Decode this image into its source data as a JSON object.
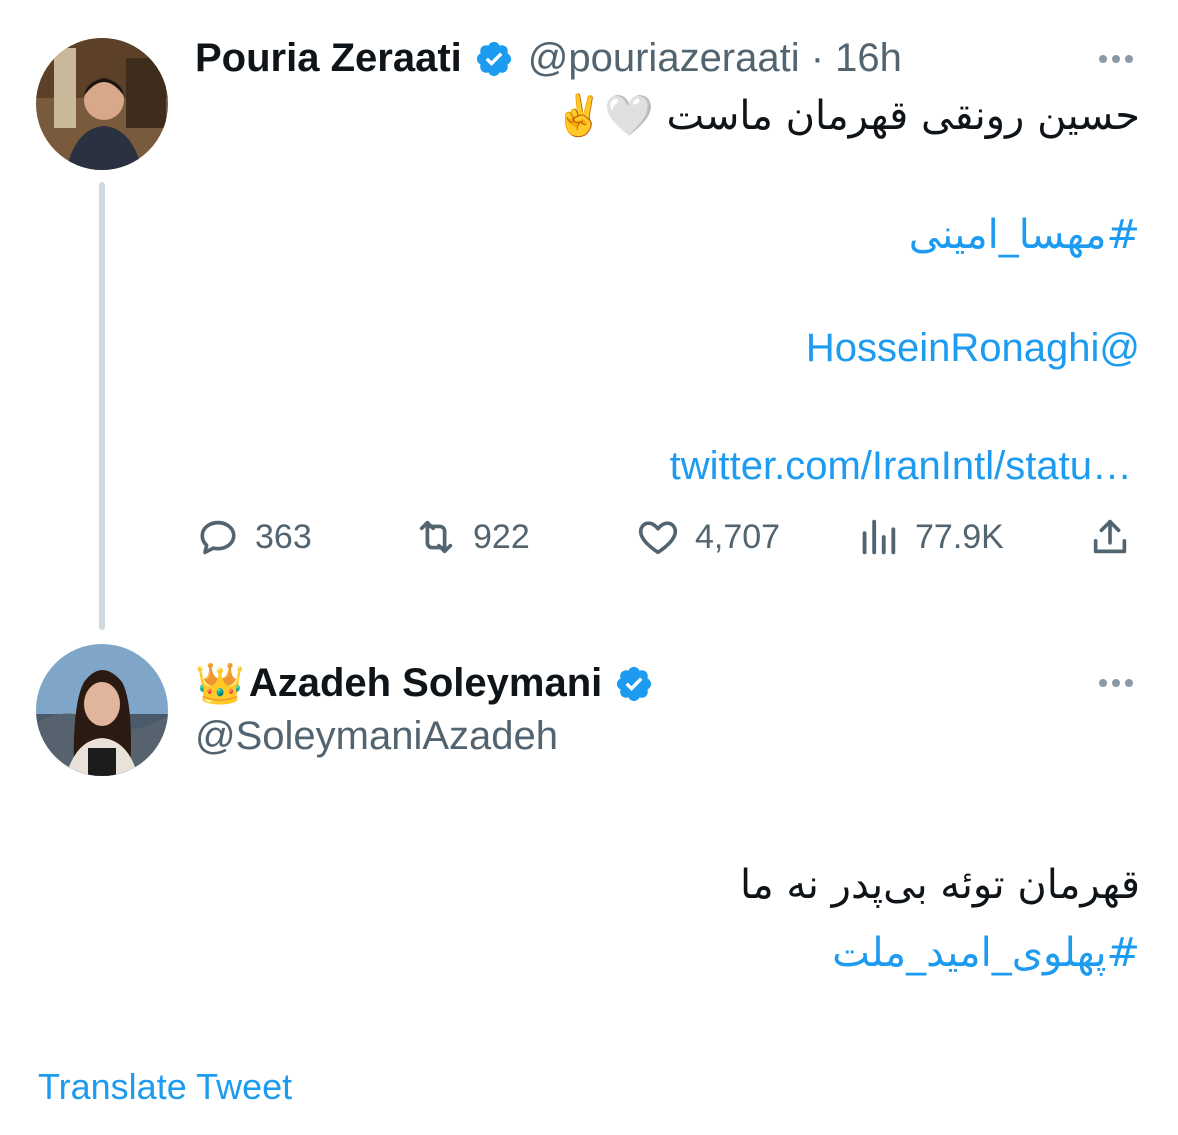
{
  "tweet1": {
    "name": "Pouria Zeraati",
    "handle_time": "@pouriazeraati · 16h",
    "text": "حسین رونقی قهرمان ماست 🤍✌️",
    "hashtag": "#مهسا_امینی",
    "mention": "@HosseinRonaghi",
    "link": "twitter.com/IranIntl/statu…",
    "metrics": {
      "replies": "363",
      "retweets": "922",
      "likes": "4,707",
      "views": "77.9K"
    }
  },
  "tweet2": {
    "name_prefix": "👑",
    "name": "Azadeh Soleymani",
    "handle": "@SoleymaniAzadeh",
    "text": "قهرمان توئه بی‌پدر نه ما",
    "hashtag": "#پهلوی_امید_ملت"
  },
  "translate_label": "Translate Tweet",
  "colors": {
    "accent": "#1d9bf0",
    "text": "#0f1419",
    "muted": "#536471",
    "thread_line": "#cfd9de"
  },
  "icons": [
    "verified-icon",
    "more-icon",
    "reply-icon",
    "retweet-icon",
    "like-icon",
    "views-icon",
    "share-icon"
  ]
}
